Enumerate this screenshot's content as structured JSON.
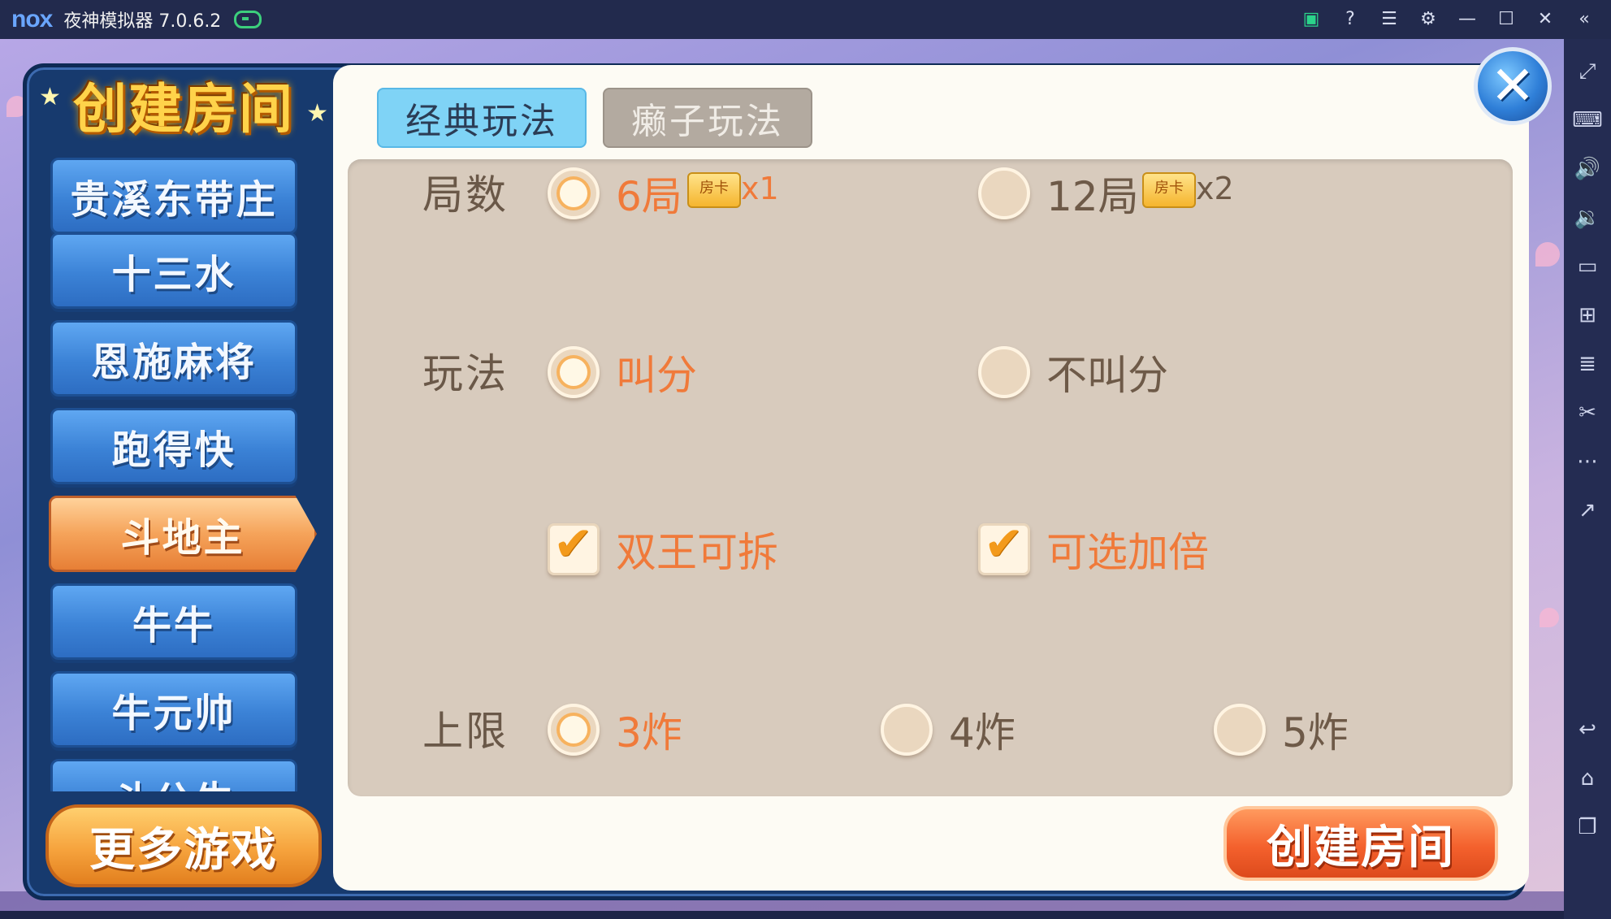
{
  "emulator": {
    "logo": "nox",
    "title": "夜神模拟器 7.0.6.2",
    "toolbar_icons": [
      "store-icon",
      "help-icon",
      "menu-icon",
      "settings-icon",
      "minimize-icon",
      "maximize-icon",
      "close-icon",
      "collapse-icon"
    ],
    "side_icons": [
      "fullscreen-icon",
      "keyboard-icon",
      "volume-up-icon",
      "volume-down-icon",
      "screen-icon",
      "add-apk-icon",
      "multi-instance-icon",
      "scissors-icon",
      "more-icon",
      "share-icon",
      "back-icon",
      "home-icon",
      "recent-apps-icon"
    ]
  },
  "dialog": {
    "title": "创建房间",
    "tabs": [
      {
        "label": "经典玩法",
        "active": true
      },
      {
        "label": "癞子玩法",
        "active": false
      }
    ],
    "games": [
      {
        "label": "贵溪东带庄"
      },
      {
        "label": "十三水"
      },
      {
        "label": "恩施麻将"
      },
      {
        "label": "跑得快"
      },
      {
        "label": "斗地主",
        "active": true
      },
      {
        "label": "牛牛"
      },
      {
        "label": "牛元帅"
      },
      {
        "label": "斗公牛"
      }
    ],
    "more_games_label": "更多游戏",
    "create_label": "创建房间",
    "close_symbol": "✕",
    "rows": {
      "rounds": {
        "label": "局数",
        "options": [
          {
            "text": "6局",
            "card": "房卡",
            "mult": "x1",
            "selected": true
          },
          {
            "text": "12局",
            "card": "房卡",
            "mult": "x2",
            "selected": false
          }
        ]
      },
      "mode": {
        "label": "玩法",
        "options": [
          {
            "text": "叫分",
            "selected": true
          },
          {
            "text": "不叫分",
            "selected": false
          }
        ]
      },
      "extras": {
        "options": [
          {
            "text": "双王可拆",
            "checked": true
          },
          {
            "text": "可选加倍",
            "checked": true
          }
        ]
      },
      "limit": {
        "label": "上限",
        "options": [
          {
            "text": "3炸",
            "selected": true
          },
          {
            "text": "4炸",
            "selected": false
          },
          {
            "text": "5炸",
            "selected": false
          }
        ]
      }
    }
  },
  "colors": {
    "selected_text": "#f07a3a",
    "normal_text": "#6e5a48",
    "panel_bg": "#d8cbbd"
  }
}
